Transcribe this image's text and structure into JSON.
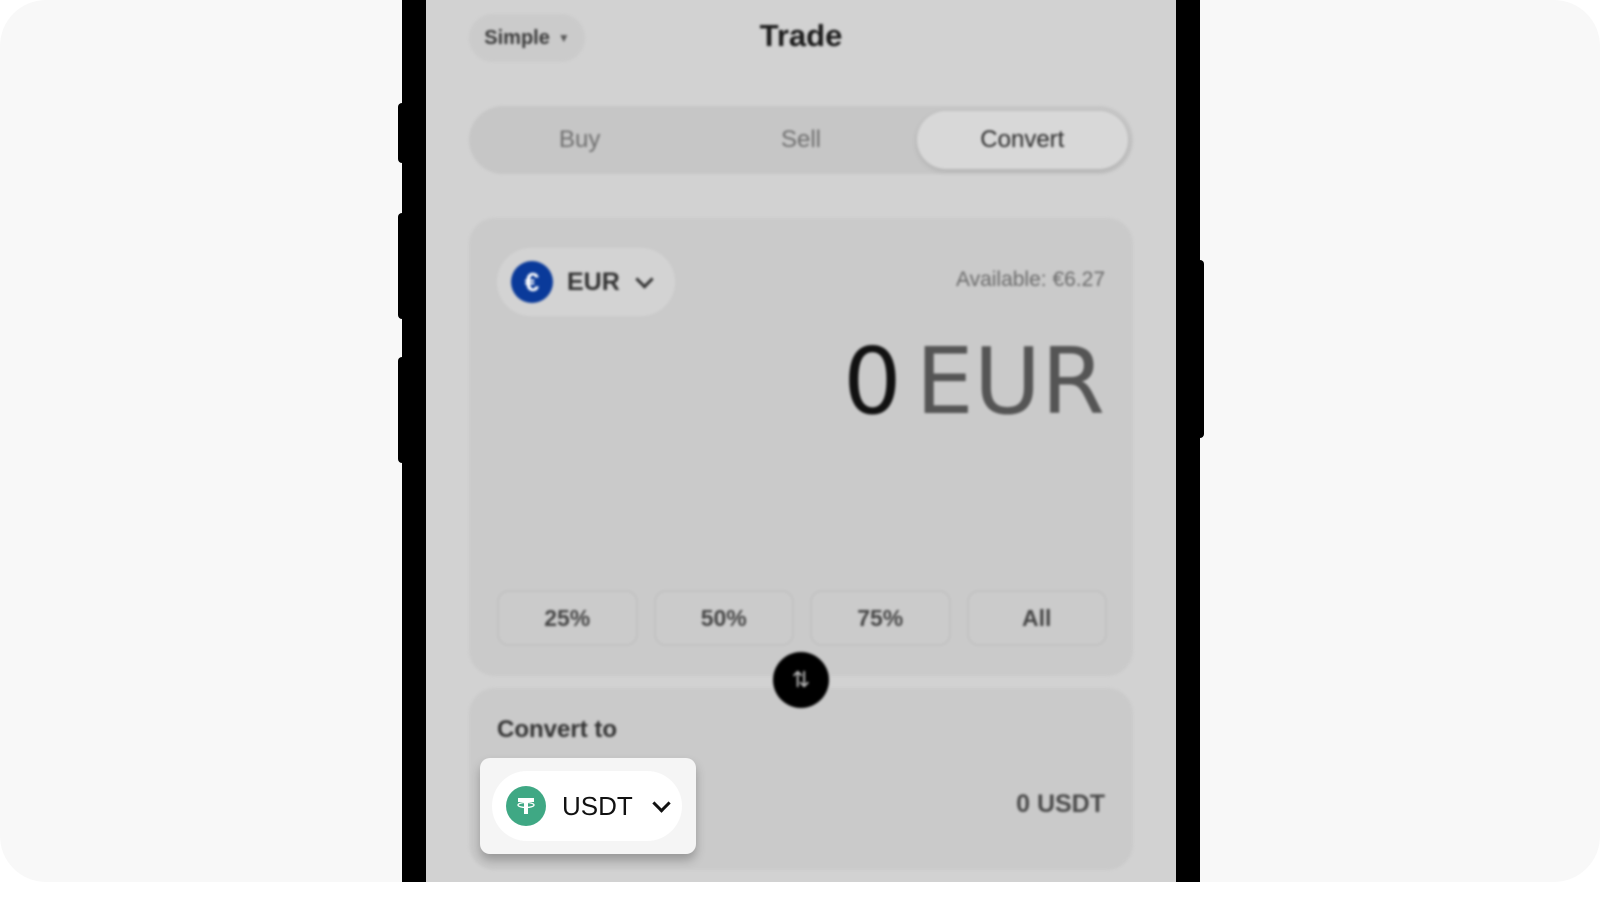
{
  "header": {
    "mode_selector": "Simple",
    "title": "Trade"
  },
  "tabs": [
    {
      "label": "Buy",
      "active": false
    },
    {
      "label": "Sell",
      "active": false
    },
    {
      "label": "Convert",
      "active": true
    }
  ],
  "from": {
    "currency": "EUR",
    "currency_icon": "euro-coin-icon",
    "available": "Available: €6.27",
    "amount": "0",
    "amount_unit": "EUR",
    "percent_buttons": [
      "25%",
      "50%",
      "75%",
      "All"
    ]
  },
  "swap": {
    "icon": "swap-arrows-icon"
  },
  "to": {
    "label": "Convert to",
    "currency": "USDT",
    "currency_icon": "tether-icon",
    "amount": "0 USDT"
  },
  "colors": {
    "eur_blue": "#0a3a9a",
    "usdt_green": "#3fa884"
  }
}
